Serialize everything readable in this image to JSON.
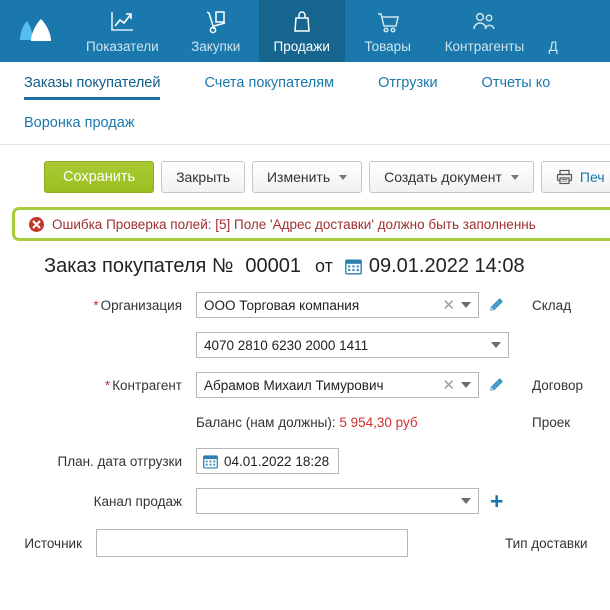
{
  "topnav": {
    "logo_name": "logo-mountains",
    "brand_color": "#1a78ac",
    "active_color": "#15658f",
    "items": [
      {
        "label": "Показатели",
        "icon": "chart-arrow-icon",
        "active": false
      },
      {
        "label": "Закупки",
        "icon": "hand-truck-icon",
        "active": false
      },
      {
        "label": "Продажи",
        "icon": "shopping-bag-icon",
        "active": true
      },
      {
        "label": "Товары",
        "icon": "shopping-cart-icon",
        "active": false
      },
      {
        "label": "Контрагенты",
        "icon": "people-icon",
        "active": false
      },
      {
        "label": "Д",
        "icon": "more-icon",
        "active": false
      }
    ]
  },
  "tabs": {
    "row1": [
      {
        "label": "Заказы покупателей",
        "active": true
      },
      {
        "label": "Счета покупателям",
        "active": false
      },
      {
        "label": "Отгрузки",
        "active": false
      },
      {
        "label": "Отчеты ко",
        "active": false
      }
    ],
    "row2": [
      {
        "label": "Воронка продаж",
        "active": false
      }
    ]
  },
  "toolbar": {
    "save_label": "Сохранить",
    "close_label": "Закрыть",
    "change_label": "Изменить",
    "create_doc_label": "Создать документ",
    "print_label": "Печ",
    "print_icon": "printer-icon"
  },
  "error": {
    "icon": "error-circle-icon",
    "text": "Ошибка Проверка полей: [5] Поле 'Адрес доставки' должно быть заполненнь",
    "border_color": "#a8cc3a",
    "text_color": "#a03030"
  },
  "document": {
    "title": "Заказ покупателя №",
    "number": "00001",
    "from_label": "от",
    "date_icon": "calendar-icon",
    "date": "09.01.2022 14:08"
  },
  "form": {
    "organization": {
      "label": "Организация",
      "required": true,
      "value": "ООО Торговая компания",
      "clear_icon": "clear-x-icon",
      "dropdown_icon": "chevron-down-icon",
      "edit_icon": "pencil-icon"
    },
    "account": {
      "value": "4070 2810 6230 2000 1411",
      "dropdown_icon": "chevron-down-icon"
    },
    "counterparty": {
      "label": "Контрагент",
      "required": true,
      "value": "Абрамов Михаил Тимурович",
      "clear_icon": "clear-x-icon",
      "dropdown_icon": "chevron-down-icon",
      "edit_icon": "pencil-icon"
    },
    "balance": {
      "label": "Баланс (нам должны):",
      "amount": "5 954,30 руб"
    },
    "ship_date": {
      "label": "План. дата отгрузки",
      "icon": "calendar-icon",
      "value": "04.01.2022 18:28"
    },
    "sales_channel": {
      "label": "Канал продаж",
      "value": "",
      "dropdown_icon": "chevron-down-icon",
      "add_icon": "plus-icon"
    },
    "source": {
      "label": "Источник",
      "value": "",
      "placeholder": ""
    },
    "right_labels": {
      "warehouse": "Склад",
      "contract": "Договор",
      "project": "Проек",
      "delivery_type": "Тип доставки"
    }
  }
}
